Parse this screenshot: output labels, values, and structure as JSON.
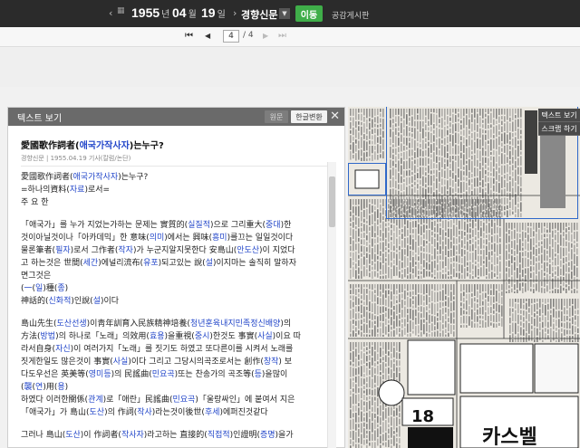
{
  "topbar": {
    "prev_arrow": "‹",
    "next_arrow": "›",
    "year": "1955",
    "year_unit": "년",
    "month": "04",
    "month_unit": "월",
    "day": "19",
    "day_unit": "일",
    "newspaper": "경향신문",
    "dropdown_icon": "chevron-down-icon",
    "move_label": "이동",
    "notice_label": "공감게시판"
  },
  "pager": {
    "current_page": "4",
    "total_label": "/ 4",
    "first_icon": "⏮",
    "prev_icon": "◀",
    "next_icon": "▶",
    "last_icon": "⏭"
  },
  "panel": {
    "title": "텍스트 보기",
    "original_btn": "원문",
    "convert_btn": "한글변환",
    "close_icon": "✕",
    "article": {
      "title_pre": "愛國歌作詞者(",
      "title_hl": "애국가작사자",
      "title_post": ")는누구?",
      "meta": "경향신문 | 1955.04.19 기사(칼럼/논단)"
    },
    "lines": [
      {
        "parts": [
          {
            "t": "愛國歌作詞者("
          },
          {
            "t": "애국가작사자",
            "h": true
          },
          {
            "t": ")는누구?"
          }
        ]
      },
      {
        "parts": [
          {
            "t": "=하나의資料("
          },
          {
            "t": "자료",
            "h": true
          },
          {
            "t": ")로서="
          }
        ]
      },
      {
        "parts": [
          {
            "t": "주 요 한"
          }
        ]
      },
      {
        "gap": true
      },
      {
        "parts": [
          {
            "t": "「애국가」를 누가 지었는가하는 문제는 實質的("
          },
          {
            "t": "실질적",
            "h": true
          },
          {
            "t": ")으로 그리重大("
          },
          {
            "t": "중대",
            "h": true
          },
          {
            "t": ")한"
          }
        ]
      },
      {
        "parts": [
          {
            "t": "것이아닐것이나「아카데믹」한 意味("
          },
          {
            "t": "의미",
            "h": true
          },
          {
            "t": ")에서는 興味("
          },
          {
            "t": "흥미",
            "h": true
          },
          {
            "t": ")를끄는 일일것이다"
          }
        ]
      },
      {
        "parts": [
          {
            "t": "물론筆者("
          },
          {
            "t": "필자",
            "h": true
          },
          {
            "t": ")로서 그作者("
          },
          {
            "t": "작자",
            "h": true
          },
          {
            "t": ")가 누군지알지못한다 安島山("
          },
          {
            "t": "안도산",
            "h": true
          },
          {
            "t": ")이 지었다"
          }
        ]
      },
      {
        "parts": [
          {
            "t": "고 하는것은 世間("
          },
          {
            "t": "세간",
            "h": true
          },
          {
            "t": ")에널리流布("
          },
          {
            "t": "유포",
            "h": true
          },
          {
            "t": ")되고있는 說("
          },
          {
            "t": "설",
            "h": true
          },
          {
            "t": ")이지마는 솔직히 말하자"
          }
        ]
      },
      {
        "parts": [
          {
            "t": "면그것은"
          }
        ]
      },
      {
        "parts": [
          {
            "t": "("
          },
          {
            "t": "一",
            "h": true
          },
          {
            "t": "("
          },
          {
            "t": "일",
            "h": true
          },
          {
            "t": ")種("
          },
          {
            "t": "종",
            "h": true
          },
          {
            "t": ")"
          }
        ]
      },
      {
        "parts": [
          {
            "t": "神話的("
          },
          {
            "t": "신화적",
            "h": true
          },
          {
            "t": ")인說("
          },
          {
            "t": "설",
            "h": true
          },
          {
            "t": ")이다"
          }
        ]
      },
      {
        "gap": true
      },
      {
        "parts": [
          {
            "t": "島山先生("
          },
          {
            "t": "도산선생",
            "h": true
          },
          {
            "t": ")이靑年訓育入民族精神培養("
          },
          {
            "t": "청년훈육내지민족정신배양",
            "h": true
          },
          {
            "t": ")의"
          }
        ]
      },
      {
        "parts": [
          {
            "t": "方法("
          },
          {
            "t": "방법",
            "h": true
          },
          {
            "t": ")의 하나로「노래」의效用("
          },
          {
            "t": "효용",
            "h": true
          },
          {
            "t": ")을重視("
          },
          {
            "t": "중시",
            "h": true
          },
          {
            "t": ")한것도 事實("
          },
          {
            "t": "사실",
            "h": true
          },
          {
            "t": ")이요 따"
          }
        ]
      },
      {
        "parts": [
          {
            "t": "라서自身("
          },
          {
            "t": "자신",
            "h": true
          },
          {
            "t": ")이 여러가지「노래」를 짓기도 하였고 또다른이를 시켜서 노래를"
          }
        ]
      },
      {
        "parts": [
          {
            "t": "짓게한일도 많은것이 事實("
          },
          {
            "t": "사실",
            "h": true
          },
          {
            "t": ")이다 그리고 그당시의곡조로서는 創作("
          },
          {
            "t": "창작",
            "h": true
          },
          {
            "t": ") 보"
          }
        ]
      },
      {
        "parts": [
          {
            "t": "다도우선은 英美等("
          },
          {
            "t": "영미등",
            "h": true
          },
          {
            "t": ")의 民謠曲("
          },
          {
            "t": "민요곡",
            "h": true
          },
          {
            "t": ")또는 찬송가의 곡조等("
          },
          {
            "t": "등",
            "h": true
          },
          {
            "t": ")을많이"
          }
        ]
      },
      {
        "parts": [
          {
            "t": "("
          },
          {
            "t": "襲",
            "h": true
          },
          {
            "t": "("
          },
          {
            "t": "연",
            "h": true
          },
          {
            "t": ")用("
          },
          {
            "t": "용",
            "h": true
          },
          {
            "t": ")"
          }
        ]
      },
      {
        "parts": [
          {
            "t": "하였다 이러한關係("
          },
          {
            "t": "관계",
            "h": true
          },
          {
            "t": ")로「애란」民謠曲("
          },
          {
            "t": "민요곡",
            "h": true
          },
          {
            "t": ")「울랑싸인」에 붙여서 지은"
          }
        ]
      },
      {
        "parts": [
          {
            "t": "「애국가」가 島山("
          },
          {
            "t": "도산",
            "h": true
          },
          {
            "t": ")의 作詞("
          },
          {
            "t": "작사",
            "h": true
          },
          {
            "t": ")라는것이後世("
          },
          {
            "t": "후세",
            "h": true
          },
          {
            "t": ")에퍼진것같다"
          }
        ]
      },
      {
        "gap": true
      },
      {
        "parts": [
          {
            "t": "그러나 島山("
          },
          {
            "t": "도산",
            "h": true
          },
          {
            "t": ")이 作詞者("
          },
          {
            "t": "작사자",
            "h": true
          },
          {
            "t": ")라고하는 直接的("
          },
          {
            "t": "직접적",
            "h": true
          },
          {
            "t": ")인證明("
          },
          {
            "t": "증명",
            "h": true
          },
          {
            "t": ")을가"
          }
        ]
      }
    ]
  },
  "side_menu": {
    "items": [
      "텍스트 보기",
      "스크랩 하기"
    ]
  },
  "newspaper_image": {
    "ad_labels": [
      "카스벨",
      "18"
    ]
  }
}
